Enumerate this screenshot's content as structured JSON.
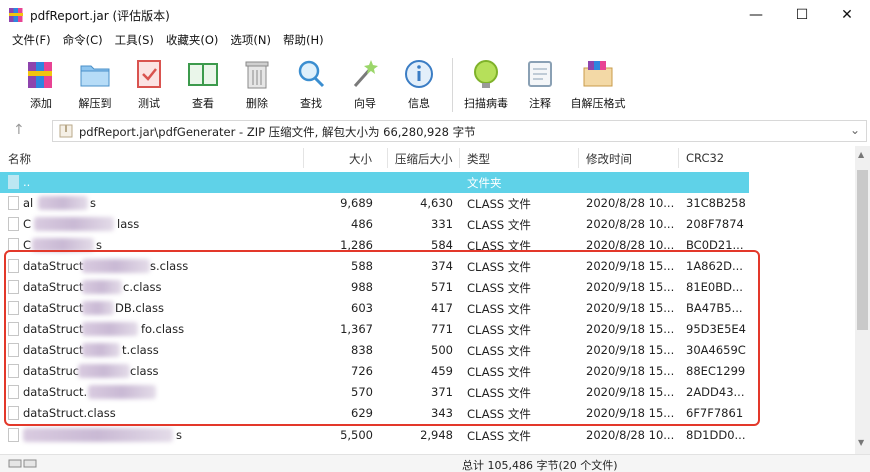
{
  "window": {
    "title": "pdfReport.jar (评估版本)",
    "min_glyph": "—",
    "max_glyph": "☐",
    "close_glyph": "✕"
  },
  "menu": [
    "文件(F)",
    "命令(C)",
    "工具(S)",
    "收藏夹(O)",
    "选项(N)",
    "帮助(H)"
  ],
  "toolbar": [
    {
      "label": "添加",
      "icon": "add-archive-icon"
    },
    {
      "label": "解压到",
      "icon": "extract-to-icon"
    },
    {
      "label": "测试",
      "icon": "test-icon"
    },
    {
      "label": "查看",
      "icon": "view-icon"
    },
    {
      "label": "删除",
      "icon": "delete-icon"
    },
    {
      "label": "查找",
      "icon": "find-icon"
    },
    {
      "label": "向导",
      "icon": "wizard-icon"
    },
    {
      "label": "信息",
      "icon": "info-icon"
    },
    {
      "label": "扫描病毒",
      "icon": "virus-scan-icon"
    },
    {
      "label": "注释",
      "icon": "comment-icon"
    },
    {
      "label": "自解压格式",
      "icon": "sfx-icon"
    }
  ],
  "address": {
    "up_glyph": "↑",
    "text": "pdfReport.jar\\pdfGenerater - ZIP 压缩文件, 解包大小为 66,280,928 字节",
    "caret": "⌄"
  },
  "columns": {
    "name": "名称",
    "size": "大小",
    "packed": "压缩后大小",
    "type": "类型",
    "modified": "修改时间",
    "crc": "CRC32"
  },
  "parent_row": {
    "name": "..",
    "type": "文件夹"
  },
  "rows": [
    {
      "name_prefix": "al",
      "name_suffix": "s",
      "size": "9,689",
      "packed": "4,630",
      "type": "CLASS 文件",
      "modified": "2020/8/28 10...",
      "crc": "31C8B258"
    },
    {
      "name_prefix": "C",
      "name_suffix": "lass",
      "size": "486",
      "packed": "331",
      "type": "CLASS 文件",
      "modified": "2020/8/28 10...",
      "crc": "208F7874"
    },
    {
      "name_prefix": "C",
      "name_suffix": "s",
      "size": "1,286",
      "packed": "584",
      "type": "CLASS 文件",
      "modified": "2020/8/28 10...",
      "crc": "BC0D21..."
    },
    {
      "name_prefix": "dataStruct",
      "name_suffix": "s.class",
      "size": "588",
      "packed": "374",
      "type": "CLASS 文件",
      "modified": "2020/9/18 15...",
      "crc": "1A862D..."
    },
    {
      "name_prefix": "dataStruct",
      "name_suffix": "c.class",
      "size": "988",
      "packed": "571",
      "type": "CLASS 文件",
      "modified": "2020/9/18 15...",
      "crc": "81E0BD..."
    },
    {
      "name_prefix": "dataStruct",
      "name_suffix": "DB.class",
      "size": "603",
      "packed": "417",
      "type": "CLASS 文件",
      "modified": "2020/9/18 15...",
      "crc": "BA47B5..."
    },
    {
      "name_prefix": "dataStruct",
      "name_suffix": "fo.class",
      "size": "1,367",
      "packed": "771",
      "type": "CLASS 文件",
      "modified": "2020/9/18 15...",
      "crc": "95D3E5E4"
    },
    {
      "name_prefix": "dataStruct",
      "name_suffix": "t.class",
      "size": "838",
      "packed": "500",
      "type": "CLASS 文件",
      "modified": "2020/9/18 15...",
      "crc": "30A4659C"
    },
    {
      "name_prefix": "dataStruc",
      "name_suffix": "class",
      "size": "726",
      "packed": "459",
      "type": "CLASS 文件",
      "modified": "2020/9/18 15...",
      "crc": "88EC1299"
    },
    {
      "name_prefix": "dataStruct.",
      "name_suffix": "",
      "size": "570",
      "packed": "371",
      "type": "CLASS 文件",
      "modified": "2020/9/18 15...",
      "crc": "2ADD43..."
    },
    {
      "name_prefix": "dataStruct.class",
      "name_suffix": "",
      "size": "629",
      "packed": "343",
      "type": "CLASS 文件",
      "modified": "2020/9/18 15...",
      "crc": "6F7F7861"
    },
    {
      "name_prefix": "",
      "name_suffix": "s",
      "size": "5,500",
      "packed": "2,948",
      "type": "CLASS 文件",
      "modified": "2020/8/28 10...",
      "crc": "8D1DD0..."
    }
  ],
  "status": {
    "text": "总计 105,486 字节(20 个文件)"
  },
  "colors": {
    "selection": "#5fd2e8",
    "highlight_box": "#e3382a"
  }
}
